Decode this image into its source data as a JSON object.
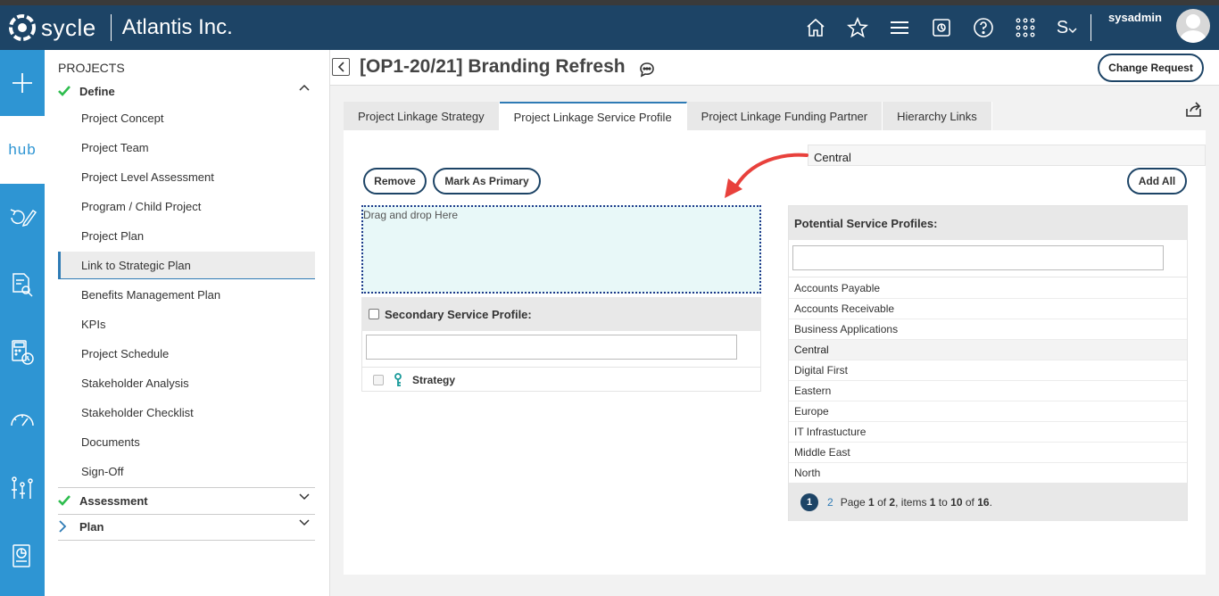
{
  "header": {
    "logo_text": "sycle",
    "company": "Atlantis Inc.",
    "icons": [
      "home-icon",
      "star-icon",
      "menu-icon",
      "export-icon",
      "help-icon",
      "apps-grid-icon",
      "s-dropdown-icon"
    ],
    "s_label": "S",
    "username": "sysadmin"
  },
  "rail": {
    "hub_label": "hub",
    "icons": [
      "plus-icon",
      "hub-icon",
      "refresh-edit-icon",
      "document-search-icon",
      "calculator-clock-icon",
      "gauge-icon",
      "org-chart-icon",
      "report-icon"
    ]
  },
  "sidebar": {
    "title": "PROJECTS",
    "define": {
      "label": "Define"
    },
    "items": [
      "Project Concept",
      "Project Team",
      "Project Level Assessment",
      "Program / Child Project",
      "Project Plan",
      "Link to Strategic Plan",
      "Benefits Management Plan",
      "KPIs",
      "Project Schedule",
      "Stakeholder Analysis",
      "Stakeholder Checklist",
      "Documents",
      "Sign-Off"
    ],
    "active_item": "Link to Strategic Plan",
    "assessment": {
      "label": "Assessment"
    },
    "plan": {
      "label": "Plan"
    }
  },
  "main": {
    "title": "[OP1-20/21] Branding Refresh",
    "change_request": "Change Request",
    "tabs": [
      {
        "label": "Project Linkage Strategy",
        "active": false
      },
      {
        "label": "Project Linkage Service Profile",
        "active": true
      },
      {
        "label": "Project Linkage Funding Partner",
        "active": false
      },
      {
        "label": "Hierarchy Links",
        "active": false
      }
    ],
    "drag_hint": "Central",
    "remove": "Remove",
    "mark_primary": "Mark As Primary",
    "add_all": "Add All",
    "dropzone": "Drag and drop Here",
    "secondary": {
      "header": "Secondary Service Profile:",
      "search_value": "",
      "row_label": "Strategy"
    },
    "potential": {
      "header": "Potential Service Profiles:",
      "search_value": "",
      "items": [
        "Accounts Payable",
        "Accounts Receivable",
        "Business Applications",
        "Central",
        "Digital First",
        "Eastern",
        "Europe",
        "IT Infrastucture",
        "Middle East",
        "North"
      ],
      "highlighted": "Central",
      "pager": {
        "current": "1",
        "next": "2",
        "text_page": "Page ",
        "page_num": "1",
        "text_of": " of ",
        "page_total": "2",
        "text_items": ", items ",
        "item_start": "1",
        "text_to": " to ",
        "item_end": "10",
        "text_of2": " of ",
        "item_total": "16",
        "text_end": "."
      }
    }
  },
  "colors": {
    "topbar": "#1d4466",
    "rail": "#2e95d3",
    "accent": "#2e7bb5",
    "check": "#2ebd4e",
    "arrow": "#e8413c",
    "dropzone_bg": "#e8f8f8"
  }
}
